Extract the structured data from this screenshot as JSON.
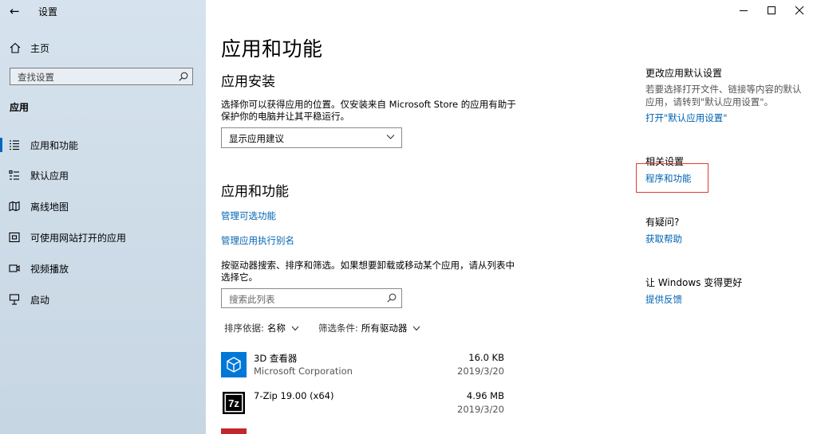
{
  "window": {
    "title": "设置",
    "back_glyph": "←",
    "controls": [
      "minimize-icon",
      "maximize-icon",
      "close-icon"
    ]
  },
  "sidebar": {
    "home_label": "主页",
    "search_placeholder": "查找设置",
    "section_title": "应用",
    "items": [
      {
        "label": "应用和功能",
        "icon": "apps-features-icon",
        "selected": true
      },
      {
        "label": "默认应用",
        "icon": "default-apps-icon",
        "selected": false
      },
      {
        "label": "离线地图",
        "icon": "offline-maps-icon",
        "selected": false
      },
      {
        "label": "可使用网站打开的应用",
        "icon": "apps-for-websites-icon",
        "selected": false
      },
      {
        "label": "视频播放",
        "icon": "video-playback-icon",
        "selected": false
      },
      {
        "label": "启动",
        "icon": "startup-icon",
        "selected": false
      }
    ]
  },
  "main": {
    "page_title": "应用和功能",
    "install_section": {
      "heading": "应用安装",
      "description_line1": "选择你可以获得应用的位置。仅安装来自 Microsoft Store 的应用有助于",
      "description_line2": "保护你的电脑并让其平稳运行。",
      "dropdown_value": "显示应用建议"
    },
    "apps_section": {
      "heading": "应用和功能",
      "link_optional_features": "管理可选功能",
      "link_app_aliases": "管理应用执行别名",
      "description_line1": "按驱动器搜索、排序和筛选。如果想要卸载或移动某个应用，请从列表中",
      "description_line2": "选择它。",
      "search_placeholder": "搜索此列表",
      "sort_label": "排序依据:",
      "sort_value": "名称",
      "filter_label": "筛选条件:",
      "filter_value": "所有驱动器"
    },
    "apps": [
      {
        "name": "3D 查看器",
        "publisher": "Microsoft Corporation",
        "size": "16.0 KB",
        "date": "2019/3/20",
        "icon": "3d-viewer-icon",
        "tile_color": "#0078d7"
      },
      {
        "name": "7-Zip 19.00 (x64)",
        "publisher": "",
        "size": "4.96 MB",
        "date": "2019/3/20",
        "icon": "7zip-icon",
        "tile_color": "#000000"
      }
    ]
  },
  "right": {
    "default_apps": {
      "heading": "更改应用默认设置",
      "text_line1": "若要选择打开文件、链接等内容的默认",
      "text_line2": "应用，请转到\"默认应用设置\"。",
      "link": "打开\"默认应用设置\""
    },
    "related": {
      "heading": "相关设置",
      "link": "程序和功能"
    },
    "question": {
      "heading": "有疑问?",
      "link": "获取帮助"
    },
    "feedback": {
      "heading": "让 Windows 变得更好",
      "link": "提供反馈"
    }
  },
  "colors": {
    "accent": "#0063b1",
    "highlight_box": "#e03c31",
    "sidebar_bg": "#d2dfeb"
  }
}
